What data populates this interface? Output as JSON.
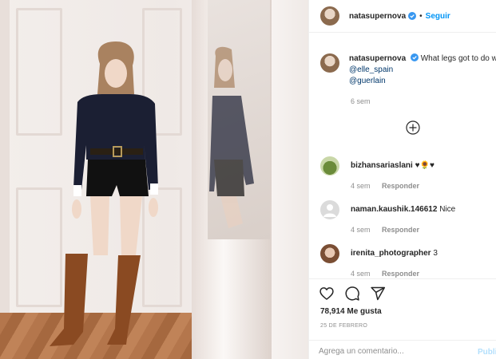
{
  "header": {
    "username": "natasupernova",
    "separator": "•",
    "follow_label": "Seguir"
  },
  "caption": {
    "username": "natasupernova",
    "text": "What legs got to do with it? 🦵❤😜",
    "mention_1": "@elle_spain",
    "mention_2": "@guerlain",
    "time": "6 sem"
  },
  "comments": [
    {
      "username": "bizhansariaslani",
      "text": "♥🌻♥",
      "time": "4 sem",
      "reply_label": "Responder"
    },
    {
      "username": "naman.kaushik.146612",
      "text": "Nice",
      "time": "4 sem",
      "reply_label": "Responder"
    },
    {
      "username": "irenita_photographer",
      "text": "3",
      "time": "4 sem",
      "reply_label": "Responder"
    }
  ],
  "actions": {
    "likes": "78,914 Me gusta",
    "date": "25 DE FEBRERO"
  },
  "add_comment": {
    "placeholder": "Agrega un comentario...",
    "publish_label": "Publicar"
  },
  "colors": {
    "accent": "#0095f6",
    "publish_disabled": "#b2dffc",
    "muted": "#8e8e8e",
    "text": "#262626"
  },
  "icons": [
    "verified-badge-icon",
    "load-more-icon",
    "heart-icon",
    "comment-icon",
    "share-icon"
  ]
}
